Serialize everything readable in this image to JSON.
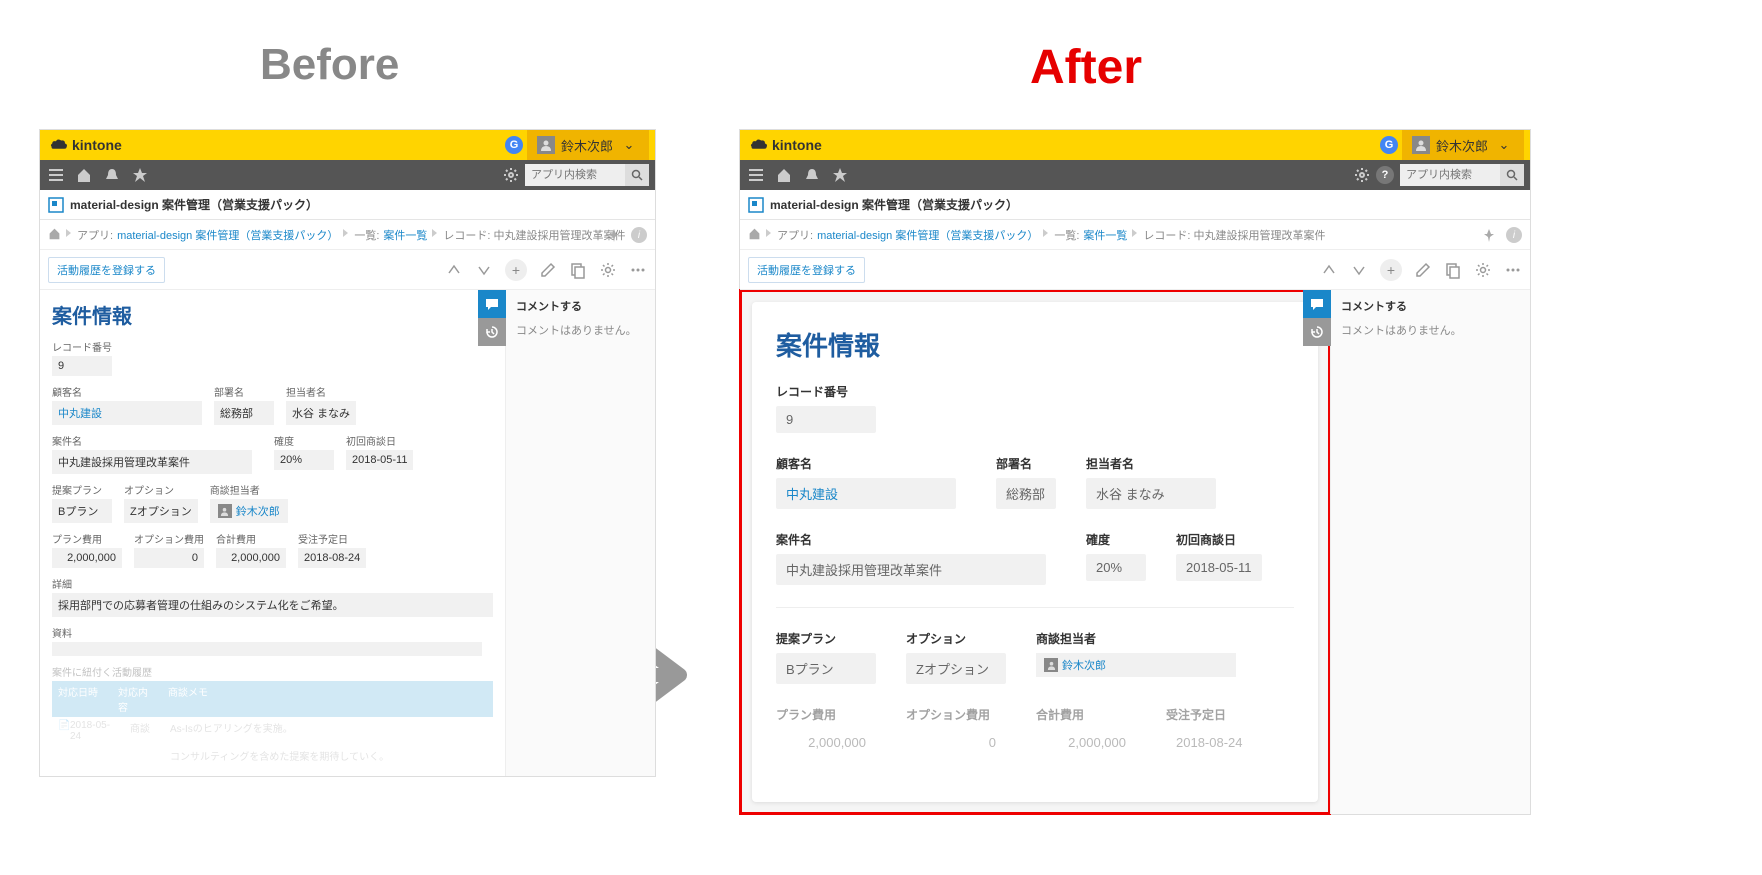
{
  "headings": {
    "before": "Before",
    "after": "After"
  },
  "brand": "kintone",
  "user": "鈴木次郎",
  "g_badge": "G",
  "search_placeholder": "アプリ内検索",
  "app_title": "material-design 案件管理（営業支援パック）",
  "crumbs": {
    "app_label": "アプリ:",
    "app_link": "material-design 案件管理（営業支援パック）",
    "list_label": "一覧:",
    "list_link": "案件一覧",
    "record_label": "レコード: 中丸建設採用管理改革案件"
  },
  "action_button": "活動履歴を登録する",
  "comment": {
    "header": "コメントする",
    "empty": "コメントはありません。"
  },
  "card_title": "案件情報",
  "fields": {
    "record_no": {
      "label": "レコード番号",
      "value": "9"
    },
    "customer": {
      "label": "顧客名",
      "value": "中丸建設"
    },
    "dept": {
      "label": "部署名",
      "value": "総務部"
    },
    "contact": {
      "label": "担当者名",
      "value": "水谷 まなみ"
    },
    "subject": {
      "label": "案件名",
      "value": "中丸建設採用管理改革案件"
    },
    "prob": {
      "label": "確度",
      "value": "20%"
    },
    "first_mtg": {
      "label": "初回商談日",
      "value": "2018-05-11"
    },
    "plan": {
      "label": "提案プラン",
      "value": "Bプラン"
    },
    "option": {
      "label": "オプション",
      "value": "Zオプション"
    },
    "sales_owner": {
      "label": "商談担当者",
      "value": "鈴木次郎"
    },
    "plan_cost": {
      "label": "プラン費用",
      "value": "2,000,000"
    },
    "option_cost": {
      "label": "オプション費用",
      "value": "0"
    },
    "total_cost": {
      "label": "合計費用",
      "value": "2,000,000"
    },
    "order_date": {
      "label": "受注予定日",
      "value": "2018-08-24"
    },
    "detail": {
      "label": "詳細",
      "value": "採用部門での応募者管理の仕組みのシステム化をご希望。"
    },
    "material": {
      "label": "資料"
    }
  },
  "before_table": {
    "section": "案件に紐付く活動履歴",
    "headers": [
      "対応日時",
      "対応内容",
      "商談メモ"
    ],
    "row": [
      "2018-05-24",
      "商談",
      "As-Isのヒアリングを実施。",
      "コンサルティングを含めた提案を期待していく。"
    ]
  }
}
